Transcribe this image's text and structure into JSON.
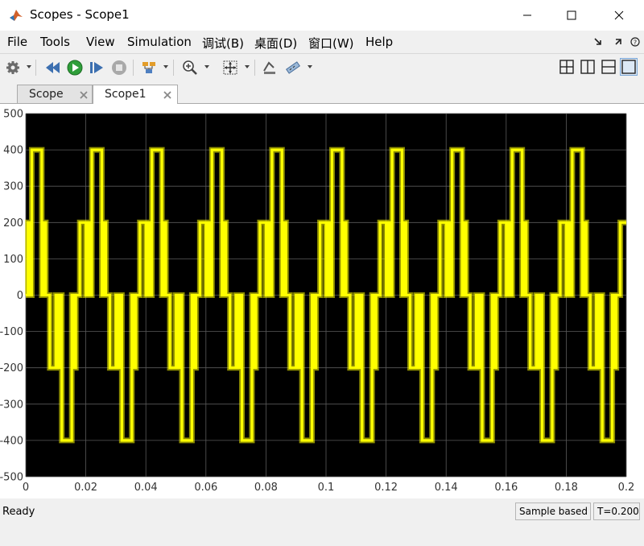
{
  "window": {
    "title": "Scopes - Scope1"
  },
  "menu": {
    "items": [
      {
        "label": "File"
      },
      {
        "label": "Tools"
      },
      {
        "label": "View"
      },
      {
        "label": "Simulation"
      },
      {
        "label": "调试(B)"
      },
      {
        "label": "桌面(D)"
      },
      {
        "label": "窗口(W)"
      },
      {
        "label": "Help"
      }
    ]
  },
  "toolbar": {
    "icons": [
      "gear-icon",
      "step-back-icon",
      "run-icon",
      "step-forward-icon",
      "stop-icon",
      "signal-selector-icon",
      "zoom-in-icon",
      "autoscale-icon",
      "style-icon",
      "measure-icon"
    ],
    "layout_icons": [
      "layout-2x2-icon",
      "layout-columns-icon",
      "layout-rows-icon",
      "layout-single-icon"
    ]
  },
  "tabs": [
    {
      "label": "Scope",
      "active": false
    },
    {
      "label": "Scope1",
      "active": true
    }
  ],
  "status": {
    "left": "Ready",
    "mode": "Sample based",
    "time": "T=0.200"
  },
  "chart_data": {
    "type": "line",
    "title": "",
    "xlabel": "",
    "ylabel": "",
    "xlim": [
      0,
      0.2
    ],
    "ylim": [
      -500,
      500
    ],
    "x_ticks": [
      "0",
      "0.02",
      "0.04",
      "0.06",
      "0.08",
      "0.1",
      "0.12",
      "0.14",
      "0.16",
      "0.18",
      "0.2"
    ],
    "y_ticks": [
      "500",
      "400",
      "300",
      "200",
      "100",
      "0",
      "-100",
      "-200",
      "-300",
      "-400",
      "-500"
    ],
    "grid": true,
    "background": "#000000",
    "line_color": "#ffff00",
    "levels": [
      -400,
      -200,
      0,
      200,
      400
    ],
    "period": 0.02,
    "series": [
      {
        "x": [
          0,
          0.00067,
          0.00067,
          0.00133,
          0.00133,
          0.002,
          0.002,
          0.00533,
          0.00533,
          0.006,
          0.006,
          0.00667,
          0.00667,
          0.008,
          0.008,
          0.01,
          0.01,
          0.01067,
          0.01067,
          0.01133,
          0.01133,
          0.012,
          0.012,
          0.01533,
          0.01533,
          0.016,
          0.016,
          0.01667,
          0.01667,
          0.018,
          0.018,
          0.02
        ],
        "y": [
          0,
          0,
          200,
          200,
          0,
          0,
          400,
          400,
          0,
          0,
          200,
          200,
          0,
          0,
          -200,
          -200,
          0,
          0,
          -200,
          -200,
          0,
          0,
          -400,
          -400,
          0,
          0,
          -200,
          -200,
          0,
          0,
          200,
          200
        ]
      }
    ]
  },
  "colors": {
    "plot_background": "#000000",
    "signal": "#ffff00",
    "grid": "#5a5a5a",
    "figure_background": "#ffffff"
  }
}
